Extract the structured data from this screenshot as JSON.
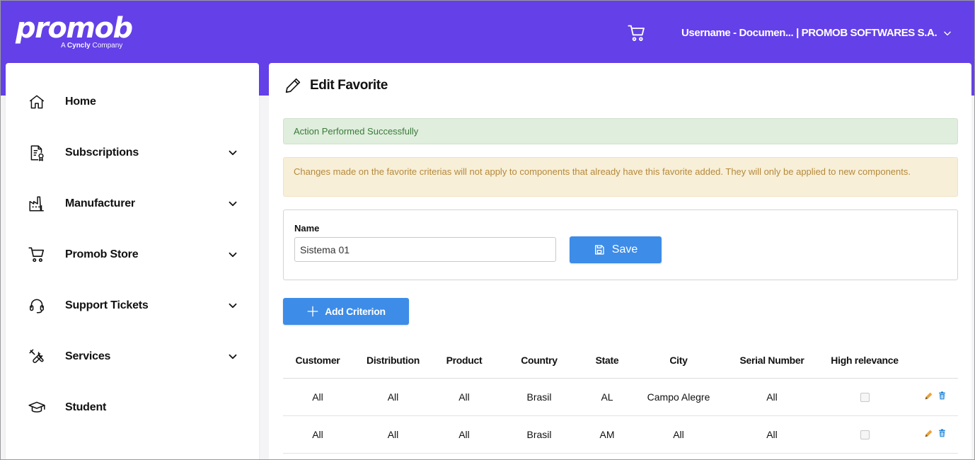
{
  "header": {
    "logo_text": "promob",
    "logo_sub_prefix": "A",
    "logo_sub_brand": "Cyncly",
    "logo_sub_suffix": "Company",
    "user_menu": "Username - Documen... | PROMOB SOFTWARES S.A."
  },
  "sidebar": {
    "items": [
      {
        "label": "Home",
        "icon": "home-icon"
      },
      {
        "label": "Subscriptions",
        "icon": "subscription-icon"
      },
      {
        "label": "Manufacturer",
        "icon": "factory-icon"
      },
      {
        "label": "Promob Store",
        "icon": "cart-icon"
      },
      {
        "label": "Support Tickets",
        "icon": "headset-icon"
      },
      {
        "label": "Services",
        "icon": "tools-icon"
      },
      {
        "label": "Student",
        "icon": "graduation-cap-icon"
      }
    ]
  },
  "main": {
    "title": "Edit Favorite",
    "success_message": "Action Performed Successfully",
    "warning_message": "Changes made on the favorite criterias will not apply to components that already have this favorite added. They will only be applied to new components.",
    "name_label": "Name",
    "name_value": "Sistema 01",
    "save_label": "Save",
    "add_criterion_label": "Add Criterion",
    "table": {
      "headers": [
        "Customer",
        "Distribution",
        "Product",
        "Country",
        "State",
        "City",
        "Serial Number",
        "High relevance"
      ],
      "rows": [
        [
          "All",
          "All",
          "All",
          "Brasil",
          "AL",
          "Campo Alegre",
          "All"
        ],
        [
          "All",
          "All",
          "All",
          "Brasil",
          "AM",
          "All",
          "All"
        ]
      ]
    }
  },
  "colors": {
    "header_bg": "#6440e8",
    "primary_button": "#3d8ce8",
    "success_bg": "#dfeedd",
    "warning_bg": "#f8efd8"
  }
}
